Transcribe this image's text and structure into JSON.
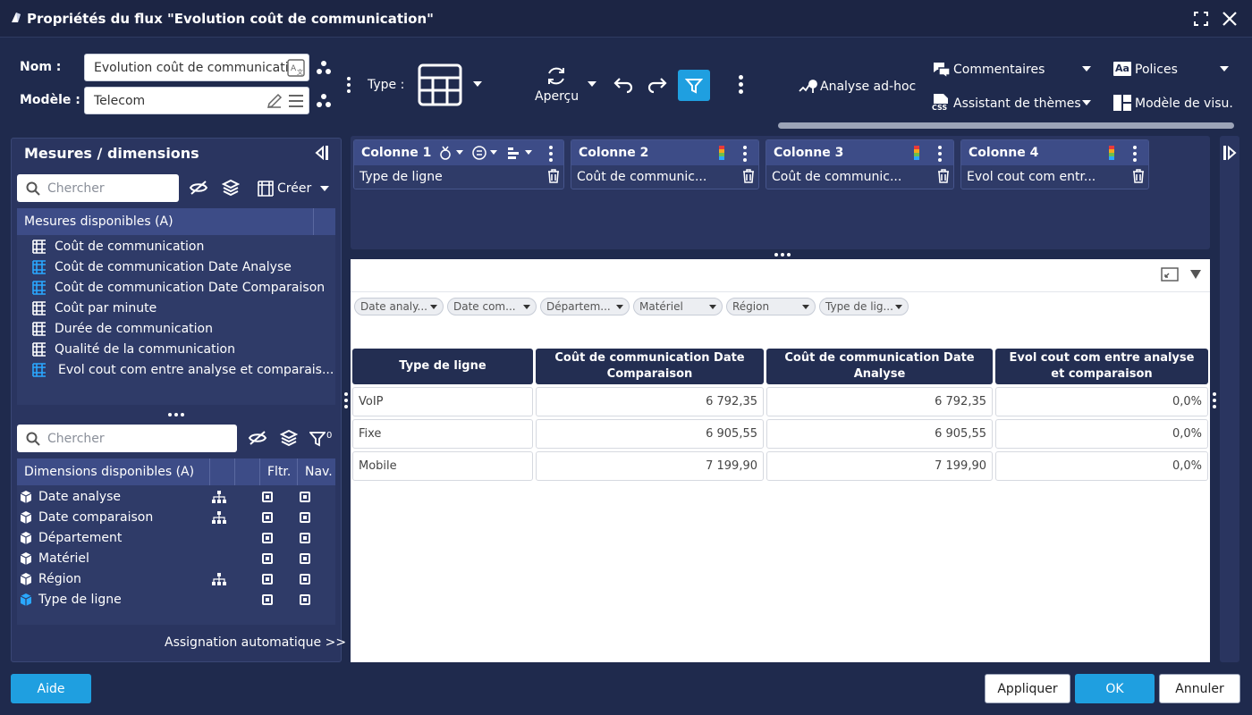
{
  "window": {
    "title": "Propriétés du flux \"Evolution coût de communication\""
  },
  "form": {
    "nom_label": "Nom :",
    "nom_value": "Evolution coût de communicati",
    "modele_label": "Modèle :",
    "modele_value": "Telecom",
    "type_label": "Type :"
  },
  "toolbar": {
    "apercu": "Aperçu",
    "analyse": "Analyse ad-hoc",
    "commentaires": "Commentaires",
    "polices": "Polices",
    "assistant": "Assistant de thèmes",
    "modele_visu": "Modèle de visu.",
    "css_badge": "CSS",
    "aa_badge": "Aa"
  },
  "left": {
    "title": "Mesures / dimensions",
    "search_placeholder": "Chercher",
    "creer": "Créer",
    "measures_header": "Mesures disponibles (A)",
    "measures": [
      "Coût de communication",
      "Coût de communication Date Analyse",
      "Coût de communication Date Comparaison",
      "Coût par minute",
      "Durée de communication",
      "Qualité de la communication",
      "Evol cout com entre analyse et comparais..."
    ],
    "search2_placeholder": "Chercher",
    "filter_count": "0",
    "dims_header": "Dimensions disponibles (A)",
    "dims_fltr": "Fltr.",
    "dims_nav": "Nav.",
    "dimensions": [
      "Date analyse",
      "Date comparaison",
      "Département",
      "Matériel",
      "Région",
      "Type de ligne"
    ],
    "auto": "Assignation automatique >>"
  },
  "columns": [
    {
      "title": "Colonne 1",
      "value": "Type de ligne"
    },
    {
      "title": "Colonne 2",
      "value": "Coût de communic..."
    },
    {
      "title": "Colonne 3",
      "value": "Coût de communic..."
    },
    {
      "title": "Colonne 4",
      "value": "Evol cout com entr..."
    }
  ],
  "filters": [
    "Date analy...",
    "Date com...",
    "Départem...",
    "Matériel",
    "Région",
    "Type de lig..."
  ],
  "table": {
    "headers": [
      "Type de ligne",
      "Coût de communication Date Comparaison",
      "Coût de communication Date Analyse",
      "Evol cout com entre analyse et comparaison"
    ],
    "rows": [
      [
        "VoIP",
        "6 792,35",
        "6 792,35",
        "0,0%"
      ],
      [
        "Fixe",
        "6 905,55",
        "6 905,55",
        "0,0%"
      ],
      [
        "Mobile",
        "7 199,90",
        "7 199,90",
        "0,0%"
      ]
    ]
  },
  "footer": {
    "aide": "Aide",
    "appliquer": "Appliquer",
    "ok": "OK",
    "annuler": "Annuler"
  },
  "colors": {
    "accent": "#1f9fe0",
    "background": "#1f2a4d",
    "panel": "#2a3560",
    "header": "#3d4c87"
  }
}
